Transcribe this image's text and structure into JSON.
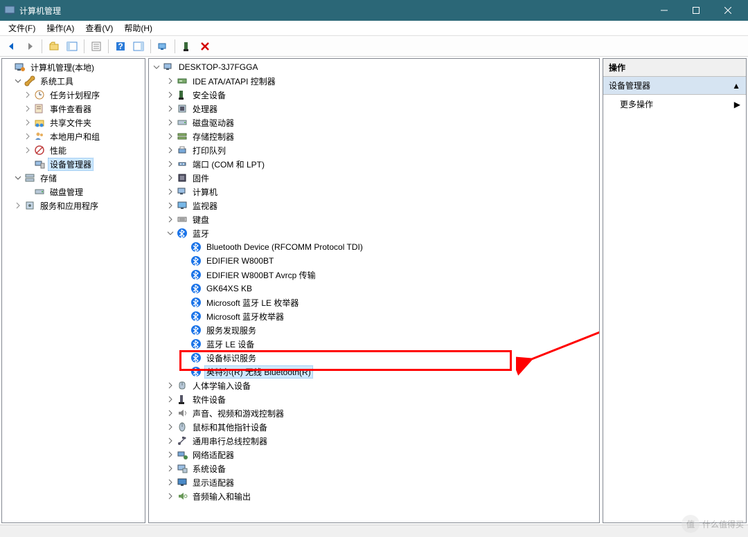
{
  "window": {
    "title": "计算机管理"
  },
  "menu": {
    "items": [
      "文件(F)",
      "操作(A)",
      "查看(V)",
      "帮助(H)"
    ]
  },
  "left_tree": {
    "root": {
      "label": "计算机管理(本地)"
    },
    "system_tools": {
      "label": "系统工具",
      "children": [
        "任务计划程序",
        "事件查看器",
        "共享文件夹",
        "本地用户和组",
        "性能",
        "设备管理器"
      ]
    },
    "storage": {
      "label": "存储",
      "children": [
        "磁盘管理"
      ]
    },
    "services": {
      "label": "服务和应用程序"
    }
  },
  "center_tree": {
    "root": "DESKTOP-3J7FGGA",
    "top_categories": [
      "IDE ATA/ATAPI 控制器",
      "安全设备",
      "处理器",
      "磁盘驱动器",
      "存储控制器",
      "打印队列",
      "端口 (COM 和 LPT)",
      "固件",
      "计算机",
      "监视器",
      "键盘"
    ],
    "bluetooth": {
      "label": "蓝牙",
      "children": [
        "Bluetooth Device (RFCOMM Protocol TDI)",
        "EDIFIER W800BT",
        "EDIFIER W800BT Avrcp 传输",
        "GK64XS KB",
        "Microsoft 蓝牙 LE 枚举器",
        "Microsoft 蓝牙枚举器",
        "服务发现服务",
        "蓝牙 LE 设备",
        "设备标识服务",
        "英特尔(R) 无线 Bluetooth(R)"
      ]
    },
    "bottom_categories": [
      "人体学输入设备",
      "软件设备",
      "声音、视频和游戏控制器",
      "鼠标和其他指针设备",
      "通用串行总线控制器",
      "网络适配器",
      "系统设备",
      "显示适配器",
      "音频输入和输出"
    ]
  },
  "right_pane": {
    "header": "操作",
    "category": "设备管理器",
    "more": "更多操作"
  },
  "watermark": {
    "text": "什么值得买",
    "badge": "值"
  }
}
